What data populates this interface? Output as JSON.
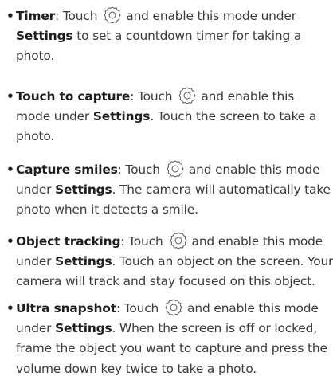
{
  "icons": {
    "settings": "settings-gear-icon"
  },
  "items": [
    {
      "title": "Timer",
      "l1_pre": ": Touch",
      "l1_post": "and enable this mode under",
      "l2_bold": "Settings",
      "l2_post": " to set a countdown timer for taking a",
      "l3": "photo."
    },
    {
      "title": "Touch to capture",
      "l1_pre": ": Touch",
      "l1_post": "and enable this",
      "l2_pre": "mode under ",
      "l2_bold": "Settings",
      "l2_post": ". Touch the screen to take a",
      "l3": "photo."
    },
    {
      "title": "Capture smiles",
      "l1_pre": ": Touch",
      "l1_post": "and enable this mode",
      "l2_pre": "under ",
      "l2_bold": "Settings",
      "l2_post": ". The camera will automatically take a",
      "l3": "photo when it detects a smile."
    },
    {
      "title": "Object tracking",
      "l1_pre": ": Touch",
      "l1_post": "and enable this mode",
      "l2_pre": "under ",
      "l2_bold": "Settings",
      "l2_post": ". Touch an object on the screen. Your",
      "l3": "camera will track and stay focused on this object."
    },
    {
      "title": "Ultra snapshot",
      "l1_pre": ": Touch",
      "l1_post": "and enable this mode",
      "l2_pre": "under ",
      "l2_bold": "Settings",
      "l2_post": ". When the screen is off or locked,",
      "l3": "frame the object you want to capture and press the",
      "l4": "volume down key twice to take a photo."
    }
  ]
}
